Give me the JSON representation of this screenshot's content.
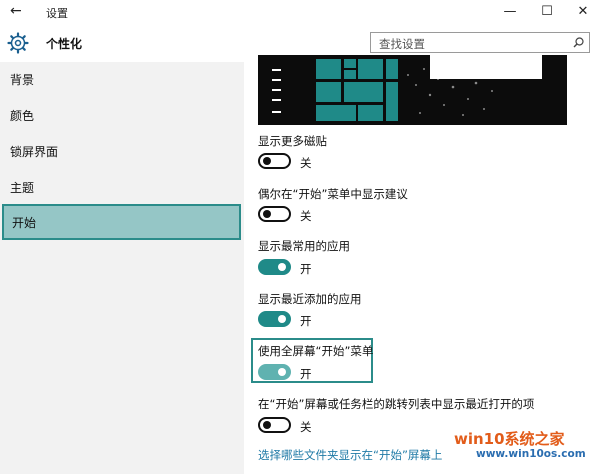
{
  "window": {
    "title": "设置",
    "back_icon": "arrow-left-icon",
    "controls": [
      "minimize-icon",
      "maximize-icon",
      "close-icon"
    ]
  },
  "header": {
    "icon": "gear-icon",
    "page_title": "个性化"
  },
  "search": {
    "placeholder": "查找设置",
    "icon": "search-icon"
  },
  "sidebar": {
    "items": [
      {
        "label": "背景",
        "active": false
      },
      {
        "label": "颜色",
        "active": false
      },
      {
        "label": "锁屏界面",
        "active": false
      },
      {
        "label": "主题",
        "active": false
      },
      {
        "label": "开始",
        "active": true
      }
    ]
  },
  "settings": [
    {
      "label": "显示更多磁贴",
      "state": "关",
      "on": false
    },
    {
      "label": "偶尔在“开始”菜单中显示建议",
      "state": "关",
      "on": false
    },
    {
      "label": "显示最常用的应用",
      "state": "开",
      "on": true
    },
    {
      "label": "显示最近添加的应用",
      "state": "开",
      "on": true
    },
    {
      "label": "使用全屏幕“开始”菜单",
      "state": "开",
      "on": true,
      "highlighted": true
    },
    {
      "label": "在“开始”屏幕或任务栏的跳转列表中显示最近打开的项",
      "state": "关",
      "on": false
    }
  ],
  "link": {
    "text": "选择哪些文件夹显示在“开始”屏幕上"
  },
  "watermark": {
    "text": "win10系统之家",
    "url": "www.win10os.com"
  },
  "colors": {
    "accent": "#1f8a88",
    "active_nav": "#95c6c6",
    "sidebar": "#f2f2f2",
    "link": "#1f7aa6"
  }
}
